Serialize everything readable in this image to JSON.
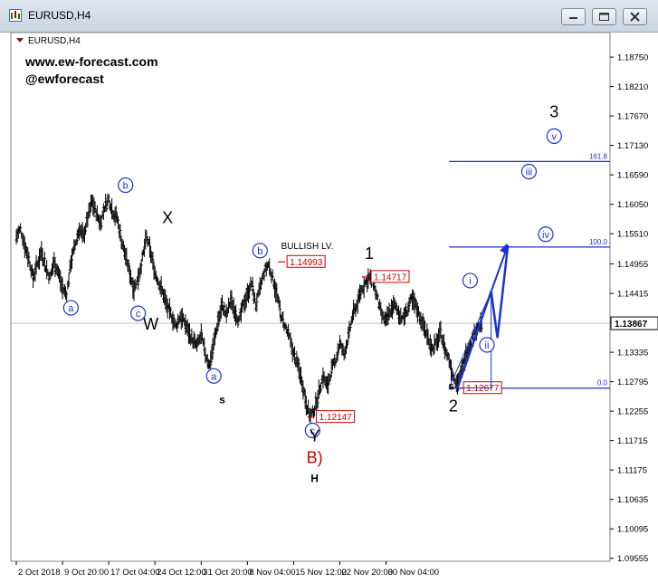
{
  "window": {
    "title": "EURUSD,H4"
  },
  "colors": {
    "bull": "#000000",
    "bear": "#000000",
    "wave": "#1a33cc",
    "level_red": "#cc0000"
  },
  "chart_data": {
    "type": "line",
    "symbol_label": "EURUSD,H4",
    "watermark": [
      "www.ew-forecast.com",
      "@ewforecast"
    ],
    "ylim": [
      1.095,
      1.192
    ],
    "y_ticks": [
      "1.18750",
      "1.18210",
      "1.17670",
      "1.17130",
      "1.16590",
      "1.16050",
      "1.15510",
      "1.14955",
      "1.14415",
      "1.13875",
      "1.13335",
      "1.12795",
      "1.12255",
      "1.11715",
      "1.11175",
      "1.10635",
      "1.10095",
      "1.09555"
    ],
    "x_ticks": [
      "2 Oct 2018",
      "9 Oct 20:00",
      "17 Oct 04:00",
      "24 Oct 12:00",
      "31 Oct 20:00",
      "8 Nov 04:00",
      "15 Nov 12:00",
      "22 Nov 20:00",
      "30 Nov 04:00"
    ],
    "x_tick_index": [
      0,
      44,
      88,
      132,
      176,
      220,
      264,
      308,
      352
    ],
    "current_price": "1.13867",
    "current_price_value": 1.13867,
    "price_path": [
      [
        0,
        1.1545
      ],
      [
        4,
        1.156
      ],
      [
        8,
        1.153
      ],
      [
        12,
        1.1505
      ],
      [
        16,
        1.147
      ],
      [
        20,
        1.1495
      ],
      [
        24,
        1.152
      ],
      [
        28,
        1.149
      ],
      [
        32,
        1.147
      ],
      [
        36,
        1.15
      ],
      [
        40,
        1.148
      ],
      [
        44,
        1.145
      ],
      [
        48,
        1.144
      ],
      [
        52,
        1.15
      ],
      [
        56,
        1.153
      ],
      [
        60,
        1.156
      ],
      [
        64,
        1.1545
      ],
      [
        68,
        1.158
      ],
      [
        72,
        1.161
      ],
      [
        76,
        1.159
      ],
      [
        80,
        1.157
      ],
      [
        84,
        1.16
      ],
      [
        88,
        1.1615
      ],
      [
        92,
        1.159
      ],
      [
        96,
        1.158
      ],
      [
        100,
        1.154
      ],
      [
        104,
        1.151
      ],
      [
        108,
        1.148
      ],
      [
        112,
        1.145
      ],
      [
        116,
        1.147
      ],
      [
        120,
        1.1505
      ],
      [
        124,
        1.1545
      ],
      [
        128,
        1.1515
      ],
      [
        132,
        1.148
      ],
      [
        136,
        1.146
      ],
      [
        140,
        1.144
      ],
      [
        144,
        1.1415
      ],
      [
        148,
        1.14
      ],
      [
        152,
        1.138
      ],
      [
        156,
        1.14
      ],
      [
        160,
        1.139
      ],
      [
        164,
        1.137
      ],
      [
        168,
        1.1355
      ],
      [
        172,
        1.1345
      ],
      [
        176,
        1.1365
      ],
      [
        180,
        1.133
      ],
      [
        184,
        1.131
      ],
      [
        188,
        1.135
      ],
      [
        192,
        1.139
      ],
      [
        196,
        1.142
      ],
      [
        200,
        1.14
      ],
      [
        204,
        1.143
      ],
      [
        208,
        1.141
      ],
      [
        212,
        1.139
      ],
      [
        216,
        1.142
      ],
      [
        220,
        1.144
      ],
      [
        224,
        1.146
      ],
      [
        228,
        1.142
      ],
      [
        232,
        1.145
      ],
      [
        236,
        1.148
      ],
      [
        240,
        1.1495
      ],
      [
        244,
        1.147
      ],
      [
        248,
        1.144
      ],
      [
        252,
        1.14
      ],
      [
        256,
        1.138
      ],
      [
        260,
        1.136
      ],
      [
        264,
        1.133
      ],
      [
        268,
        1.131
      ],
      [
        272,
        1.128
      ],
      [
        276,
        1.124
      ],
      [
        280,
        1.1215
      ],
      [
        284,
        1.123
      ],
      [
        288,
        1.126
      ],
      [
        292,
        1.129
      ],
      [
        296,
        1.127
      ],
      [
        300,
        1.13
      ],
      [
        304,
        1.132
      ],
      [
        308,
        1.135
      ],
      [
        312,
        1.133
      ],
      [
        316,
        1.136
      ],
      [
        320,
        1.14
      ],
      [
        324,
        1.142
      ],
      [
        328,
        1.1445
      ],
      [
        332,
        1.146
      ],
      [
        336,
        1.147
      ],
      [
        340,
        1.146
      ],
      [
        344,
        1.143
      ],
      [
        348,
        1.14
      ],
      [
        352,
        1.139
      ],
      [
        356,
        1.141
      ],
      [
        360,
        1.142
      ],
      [
        364,
        1.1405
      ],
      [
        368,
        1.1395
      ],
      [
        372,
        1.141
      ],
      [
        376,
        1.143
      ],
      [
        380,
        1.142
      ],
      [
        384,
        1.14
      ],
      [
        388,
        1.138
      ],
      [
        392,
        1.136
      ],
      [
        396,
        1.134
      ],
      [
        400,
        1.135
      ],
      [
        404,
        1.137
      ],
      [
        408,
        1.134
      ],
      [
        412,
        1.132
      ],
      [
        416,
        1.129
      ],
      [
        420,
        1.1275
      ],
      [
        424,
        1.13
      ],
      [
        428,
        1.133
      ],
      [
        432,
        1.135
      ],
      [
        436,
        1.137
      ],
      [
        440,
        1.138
      ],
      [
        444,
        1.1387
      ]
    ],
    "x_total": 560,
    "levels": [
      {
        "label": "161.8",
        "value": 1.16835,
        "x_from": 412,
        "x_to": 560
      },
      {
        "label": "100.0",
        "value": 1.15265,
        "x_from": 412,
        "x_to": 560
      },
      {
        "label": "0.0",
        "value": 1.12677,
        "x_from": 412,
        "x_to": 560
      }
    ],
    "price_labels": [
      {
        "text": "1.14993",
        "value": 1.14993,
        "at": 256
      },
      {
        "text": "1.14717",
        "value": 1.14717,
        "at": 336
      },
      {
        "text": "1.12677",
        "value": 1.12677,
        "at": 424
      },
      {
        "text": "1.12147",
        "value": 1.12147,
        "at": 284
      }
    ],
    "annotations": {
      "bullish_lv": "BULLISH LV.",
      "blue_circled": [
        {
          "text": "b",
          "at": 104,
          "value": 1.164
        },
        {
          "text": "a",
          "at": 52,
          "value": 1.1415
        },
        {
          "text": "c",
          "at": 116,
          "value": 1.1405
        },
        {
          "text": "a",
          "at": 188,
          "value": 1.129
        },
        {
          "text": "b",
          "at": 232,
          "value": 1.152
        },
        {
          "text": "c",
          "at": 282,
          "value": 1.119
        },
        {
          "text": "i",
          "at": 432,
          "value": 1.1465
        },
        {
          "text": "ii",
          "at": 448,
          "value": 1.1347
        },
        {
          "text": "iii",
          "at": 488,
          "value": 1.1665
        },
        {
          "text": "iv",
          "at": 504,
          "value": 1.155
        },
        {
          "text": "v",
          "at": 512,
          "value": 1.173
        }
      ],
      "black_labels": [
        {
          "text": "X",
          "at": 144,
          "value": 1.157
        },
        {
          "text": "W",
          "at": 128,
          "value": 1.1375
        },
        {
          "text": "1",
          "at": 336,
          "value": 1.1505
        },
        {
          "text": "3",
          "at": 512,
          "value": 1.1765
        },
        {
          "text": "Y",
          "at": 284,
          "value": 1.117
        },
        {
          "text": "2",
          "at": 416,
          "value": 1.1225
        }
      ],
      "small_labels": [
        {
          "text": "s",
          "at": 196,
          "value": 1.124
        },
        {
          "text": "s",
          "at": 414,
          "value": 1.1265
        },
        {
          "text": "H",
          "at": 284,
          "value": 1.1095
        }
      ],
      "red_label": {
        "text": "B)",
        "at": 284,
        "value": 1.113
      }
    },
    "projection": [
      [
        420,
        1.1268
      ],
      [
        452,
        1.1445
      ],
      [
        458,
        1.136
      ],
      [
        468,
        1.153
      ]
    ],
    "triangle": [
      [
        412,
        1.1268
      ],
      [
        452,
        1.1268
      ],
      [
        452,
        1.1445
      ]
    ]
  }
}
